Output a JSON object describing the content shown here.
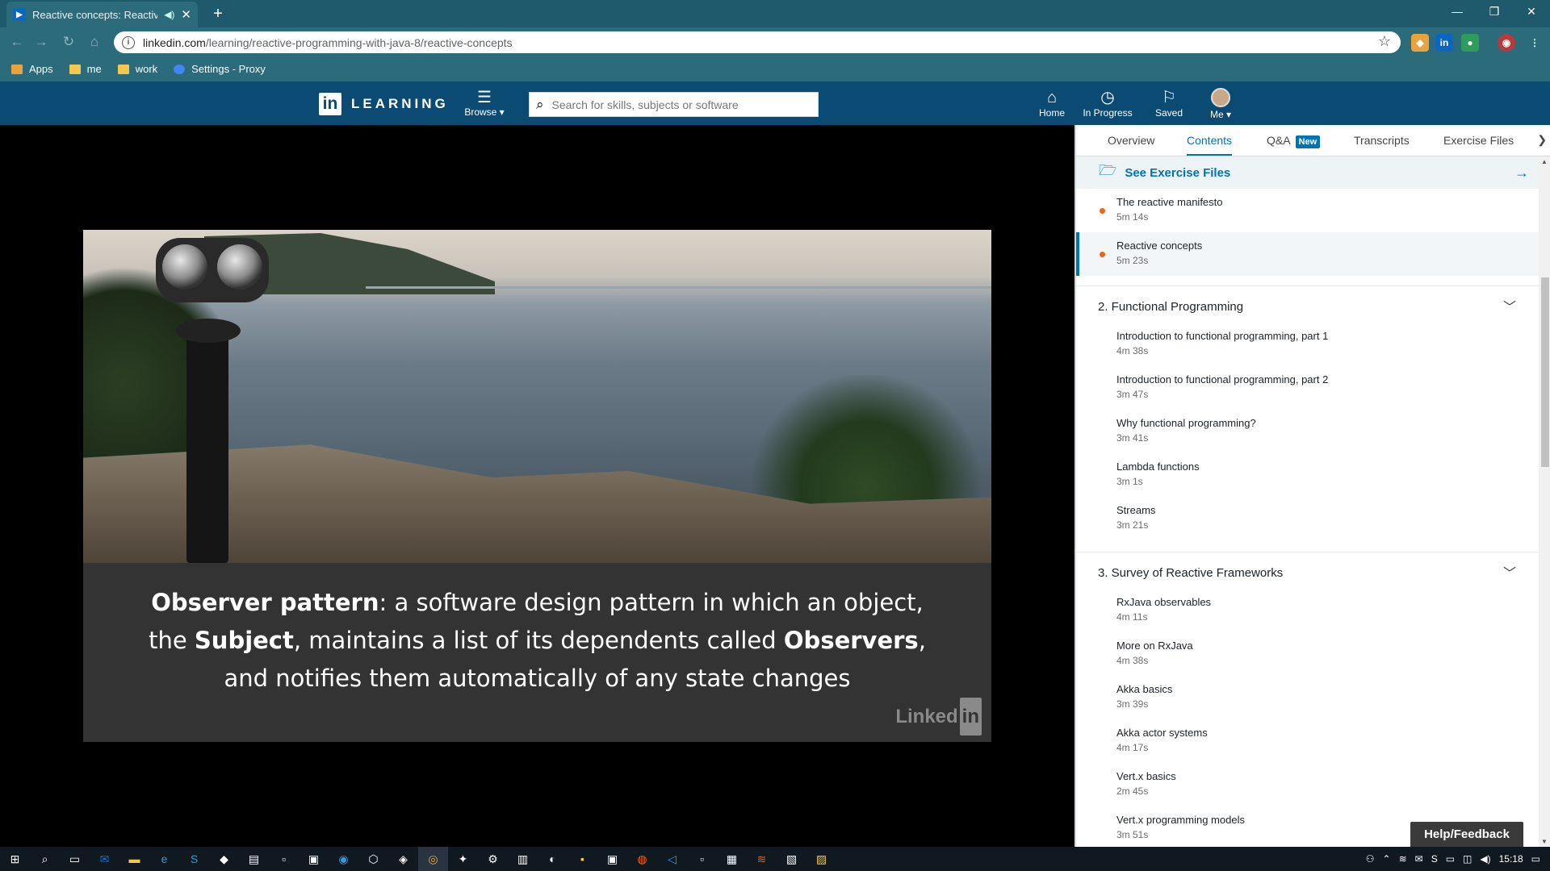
{
  "browser": {
    "tab_title": "Reactive concepts: Reactive P",
    "new_tab": "+",
    "url_host": "linkedin.com",
    "url_path": "/learning/reactive-programming-with-java-8/reactive-concepts",
    "bookmarks": [
      {
        "label": "Apps",
        "color": "#e8a33c"
      },
      {
        "label": "me",
        "color": "#f2c94c"
      },
      {
        "label": "work",
        "color": "#f2c94c"
      },
      {
        "label": "Settings - Proxy",
        "color": "#4285f4"
      }
    ]
  },
  "header": {
    "logo": "in",
    "brand": "LEARNING",
    "browse": "Browse ▾",
    "search_placeholder": "Search for skills, subjects or software",
    "nav": {
      "home": "Home",
      "in_progress": "In Progress",
      "saved": "Saved",
      "me": "Me ▾"
    }
  },
  "video": {
    "caption_line1_bold": "Observer pattern",
    "caption_line1_rest": ": a software design pattern in which an object,",
    "caption_line2_pre": "the ",
    "caption_line2_bold1": "Subject",
    "caption_line2_mid": ", maintains a list of its dependents called ",
    "caption_line2_bold2": "Observers",
    "caption_line2_end": ",",
    "caption_line3": "and notifies them automatically of any state changes",
    "watermark": "Linked",
    "watermark_in": "in"
  },
  "panel": {
    "tabs": {
      "overview": "Overview",
      "contents": "Contents",
      "qa": "Q&A",
      "qa_badge": "New",
      "transcripts": "Transcripts",
      "exercise": "Exercise Files",
      "next": "❯"
    },
    "exercise_link": "See Exercise Files",
    "top_items": [
      {
        "title": "The reactive manifesto",
        "duration": "5m 14s"
      },
      {
        "title": "Reactive concepts",
        "duration": "5m 23s"
      }
    ],
    "sections": [
      {
        "title": "2. Functional Programming",
        "items": [
          {
            "title": "Introduction to functional programming, part 1",
            "duration": "4m 38s"
          },
          {
            "title": "Introduction to functional programming, part 2",
            "duration": "3m 47s"
          },
          {
            "title": "Why functional programming?",
            "duration": "3m 41s"
          },
          {
            "title": "Lambda functions",
            "duration": "3m 1s"
          },
          {
            "title": "Streams",
            "duration": "3m 21s"
          }
        ]
      },
      {
        "title": "3. Survey of Reactive Frameworks",
        "items": [
          {
            "title": "RxJava observables",
            "duration": "4m 11s"
          },
          {
            "title": "More on RxJava",
            "duration": "4m 38s"
          },
          {
            "title": "Akka basics",
            "duration": "3m 39s"
          },
          {
            "title": "Akka actor systems",
            "duration": "4m 17s"
          },
          {
            "title": "Vert.x basics",
            "duration": "2m 45s"
          },
          {
            "title": "Vert.x programming models",
            "duration": "3m 51s"
          }
        ]
      }
    ],
    "help": "Help/Feedback"
  },
  "taskbar": {
    "clock": "15:18"
  },
  "colors": {
    "brand": "#0b4a72",
    "accent": "#0073b1",
    "progress_dot": "#e4671b"
  }
}
